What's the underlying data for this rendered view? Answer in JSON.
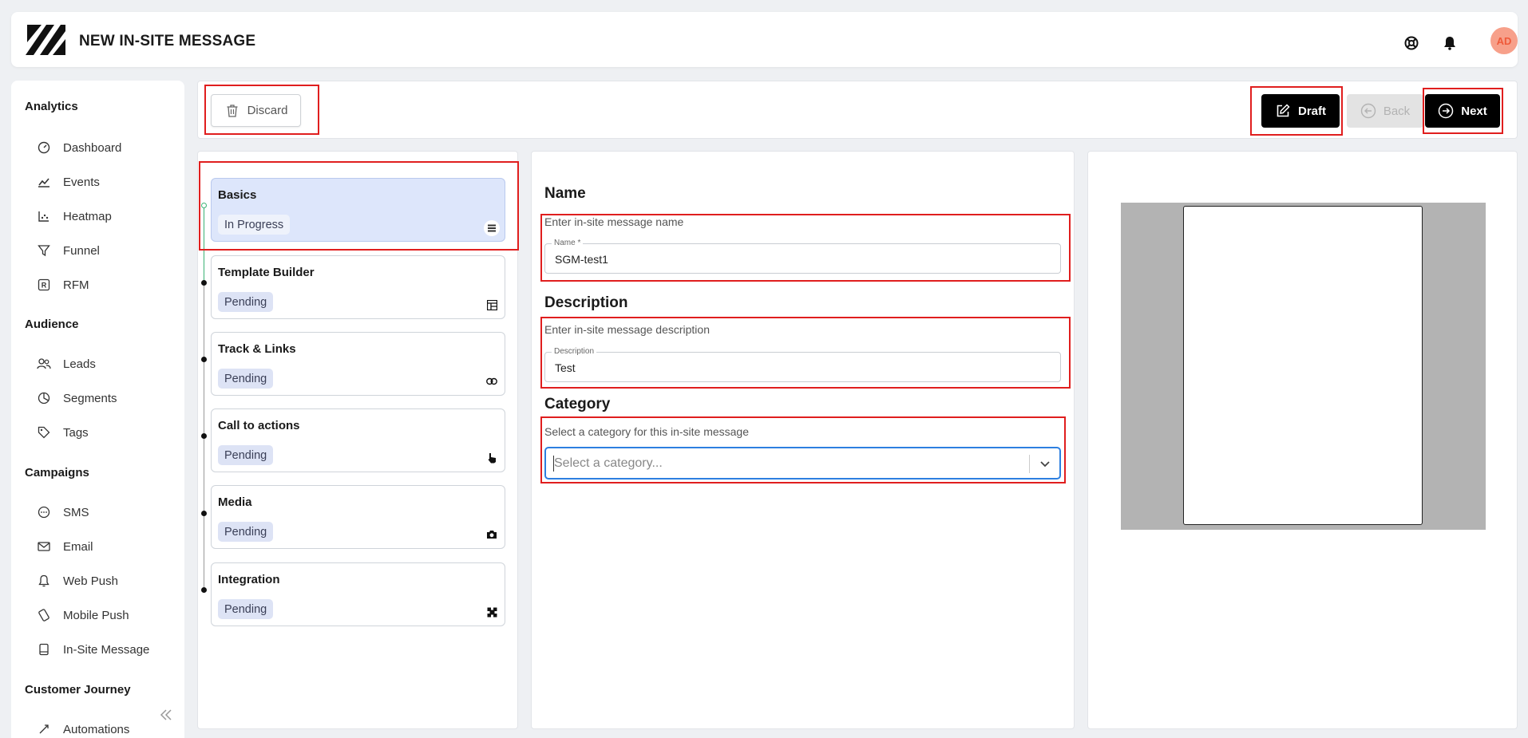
{
  "header": {
    "title": "NEW IN-SITE MESSAGE",
    "avatar_initials": "AD",
    "icons": [
      "support-icon",
      "bell-icon"
    ]
  },
  "sidebar": {
    "sections": [
      {
        "title": "Analytics",
        "items": [
          {
            "label": "Dashboard",
            "icon": "dashboard-icon"
          },
          {
            "label": "Events",
            "icon": "events-icon"
          },
          {
            "label": "Heatmap",
            "icon": "heatmap-icon"
          },
          {
            "label": "Funnel",
            "icon": "funnel-icon"
          },
          {
            "label": "RFM",
            "icon": "rfm-icon"
          }
        ]
      },
      {
        "title": "Audience",
        "items": [
          {
            "label": "Leads",
            "icon": "leads-icon"
          },
          {
            "label": "Segments",
            "icon": "segments-icon"
          },
          {
            "label": "Tags",
            "icon": "tag-icon"
          }
        ]
      },
      {
        "title": "Campaigns",
        "items": [
          {
            "label": "SMS",
            "icon": "sms-icon"
          },
          {
            "label": "Email",
            "icon": "email-icon"
          },
          {
            "label": "Web Push",
            "icon": "bell-icon"
          },
          {
            "label": "Mobile Push",
            "icon": "mobile-push-icon"
          },
          {
            "label": "In-Site Message",
            "icon": "in-site-message-icon"
          }
        ]
      },
      {
        "title": "Customer Journey",
        "items": [
          {
            "label": "Automations",
            "icon": "automations-icon"
          }
        ]
      }
    ]
  },
  "actions": {
    "discard_label": "Discard",
    "draft_label": "Draft",
    "back_label": "Back",
    "next_label": "Next"
  },
  "steps": [
    {
      "title": "Basics",
      "status": "In Progress",
      "icon": "list-icon",
      "active": true
    },
    {
      "title": "Template Builder",
      "status": "Pending",
      "icon": "template-icon"
    },
    {
      "title": "Track & Links",
      "status": "Pending",
      "icon": "link-icon"
    },
    {
      "title": "Call to actions",
      "status": "Pending",
      "icon": "pointer-icon"
    },
    {
      "title": "Media",
      "status": "Pending",
      "icon": "camera-icon"
    },
    {
      "title": "Integration",
      "status": "Pending",
      "icon": "integration-icon"
    }
  ],
  "form": {
    "name": {
      "heading": "Name",
      "hint": "Enter in-site message name",
      "field_label": "Name *",
      "value": "SGM-test1"
    },
    "description": {
      "heading": "Description",
      "hint": "Enter in-site message description",
      "field_label": "Description",
      "value": "Test"
    },
    "category": {
      "heading": "Category",
      "hint": "Select a category for this in-site message",
      "placeholder": "Select a category..."
    }
  },
  "colors": {
    "accent": "#2d7fe0",
    "highlight": "#e01e1e",
    "active_step": "#dde6fb",
    "avatar_bg": "#f7a08a"
  }
}
